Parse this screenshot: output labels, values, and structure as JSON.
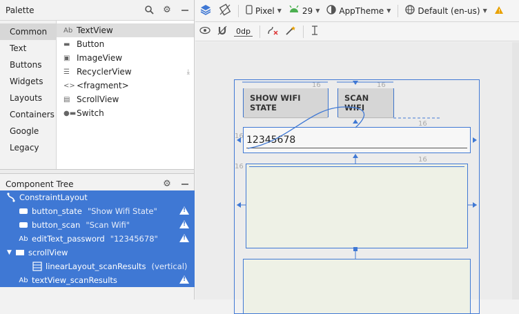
{
  "palette": {
    "title": "Palette",
    "categories": [
      "Common",
      "Text",
      "Buttons",
      "Widgets",
      "Layouts",
      "Containers",
      "Google",
      "Legacy"
    ],
    "items": [
      {
        "icon": "textview-icon",
        "glyph": "Ab",
        "label": "TextView"
      },
      {
        "icon": "button-icon",
        "glyph": "▬",
        "label": "Button"
      },
      {
        "icon": "imageview-icon",
        "glyph": "▣",
        "label": "ImageView"
      },
      {
        "icon": "recyclerview-icon",
        "glyph": "☰",
        "label": "RecyclerView"
      },
      {
        "icon": "fragment-icon",
        "glyph": "<>",
        "label": "<fragment>"
      },
      {
        "icon": "scrollview-icon",
        "glyph": "▤",
        "label": "ScrollView"
      },
      {
        "icon": "switch-icon",
        "glyph": "●▬",
        "label": "Switch"
      }
    ]
  },
  "tree": {
    "title": "Component Tree",
    "nodes": [
      {
        "label": "ConstraintLayout",
        "quote": "",
        "warn": false
      },
      {
        "label": "button_state",
        "quote": "\"Show Wifi State\"",
        "warn": true
      },
      {
        "label": "button_scan",
        "quote": "\"Scan Wifi\"",
        "warn": true
      },
      {
        "label": "editText_password",
        "quote": "\"12345678\"",
        "warn": true
      },
      {
        "label": "scrollView",
        "quote": "",
        "warn": false
      },
      {
        "label": "linearLayout_scanResults",
        "quote": "(vertical)",
        "warn": false
      },
      {
        "label": "textView_scanResults",
        "quote": "",
        "warn": true
      }
    ]
  },
  "toolbar": {
    "device": "Pixel",
    "api": "29",
    "theme": "AppTheme",
    "locale": "Default (en-us)",
    "margin": "0dp"
  },
  "canvas": {
    "button_state": "SHOW WIFI STATE",
    "button_scan": "SCAN WIFI",
    "edit_text": "12345678",
    "margin_label": "16",
    "accent": "#3f78d4"
  }
}
